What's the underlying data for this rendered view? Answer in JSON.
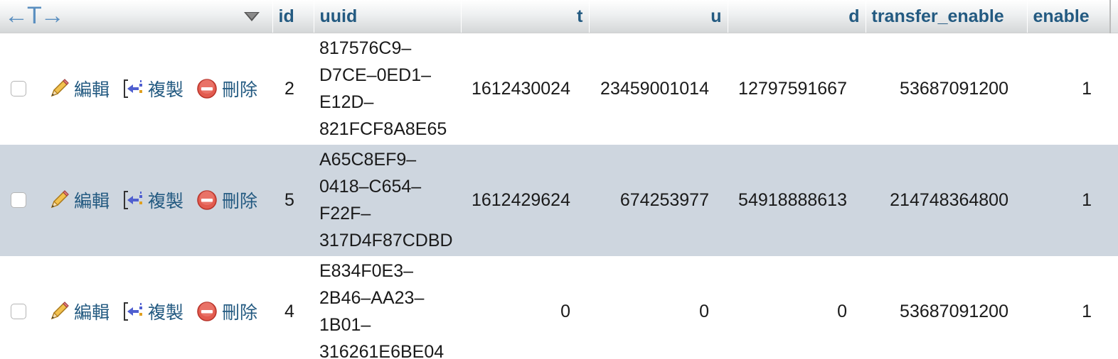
{
  "header": {
    "arrows": "←T→",
    "columns": [
      {
        "key": "id",
        "label": "id"
      },
      {
        "key": "uuid",
        "label": "uuid"
      },
      {
        "key": "t",
        "label": "t"
      },
      {
        "key": "u",
        "label": "u"
      },
      {
        "key": "d",
        "label": "d"
      },
      {
        "key": "transfer_enable",
        "label": "transfer_enable"
      },
      {
        "key": "enable",
        "label": "enable"
      }
    ]
  },
  "actions": {
    "edit": "編輯",
    "copy": "複製",
    "delete": "刪除"
  },
  "rows": [
    {
      "id": "2",
      "uuid_lines": [
        "817576C9–",
        "D7CE–0ED1–",
        "E12D–",
        "821FCF8A8E65"
      ],
      "t": "1612430024",
      "u": "23459001014",
      "d": "12797591667",
      "transfer_enable": "53687091200",
      "enable": "1"
    },
    {
      "id": "5",
      "uuid_lines": [
        "A65C8EF9–",
        "0418–C654–",
        "F22F–",
        "317D4F87CDBD"
      ],
      "t": "1612429624",
      "u": "674253977",
      "d": "54918888613",
      "transfer_enable": "214748364800",
      "enable": "1"
    },
    {
      "id": "4",
      "uuid_lines": [
        "E834F0E3–",
        "2B46–AA23–",
        "1B01–",
        "316261E6BE04"
      ],
      "t": "0",
      "u": "0",
      "d": "0",
      "transfer_enable": "53687091200",
      "enable": "1"
    }
  ],
  "colors": {
    "link": "#235a81",
    "selected_row": "#ced6df",
    "header_arrows": "#5a8fc0"
  }
}
